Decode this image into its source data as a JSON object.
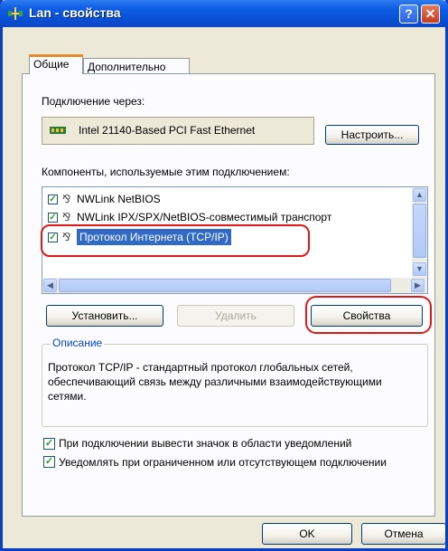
{
  "window": {
    "title": "Lan - свойства"
  },
  "tabs": [
    {
      "label": "Общие",
      "active": true
    },
    {
      "label": "Дополнительно",
      "active": false
    }
  ],
  "connection": {
    "label": "Подключение через:",
    "adapter_name": "Intel 21140-Based PCI Fast Ethernet",
    "configure_button": "Настроить..."
  },
  "components": {
    "label": "Компоненты, используемые этим подключением:",
    "items": [
      {
        "label": "NWLink NetBIOS",
        "checked": true,
        "selected": false
      },
      {
        "label": "NWLink IPX/SPX/NetBIOS-совместимый транспорт",
        "checked": true,
        "selected": false
      },
      {
        "label": "Протокол Интернета (TCP/IP)",
        "checked": true,
        "selected": true
      }
    ]
  },
  "buttons": {
    "install": "Установить...",
    "remove": "Удалить",
    "properties": "Свойства",
    "ok": "OK",
    "cancel": "Отмена"
  },
  "description": {
    "legend": "Описание",
    "text": "Протокол TCP/IP - стандартный протокол глобальных сетей, обеспечивающий связь между различными взаимодействующими сетями."
  },
  "options": {
    "show_icon": {
      "label": "При подключении вывести значок в области уведомлений",
      "checked": true
    },
    "notify_limited": {
      "label": "Уведомлять при ограниченном или отсутствующем подключении",
      "checked": true
    }
  },
  "colors": {
    "titlebar": "#0a50d6",
    "selection": "#316ac5",
    "annotation": "#e01818"
  }
}
